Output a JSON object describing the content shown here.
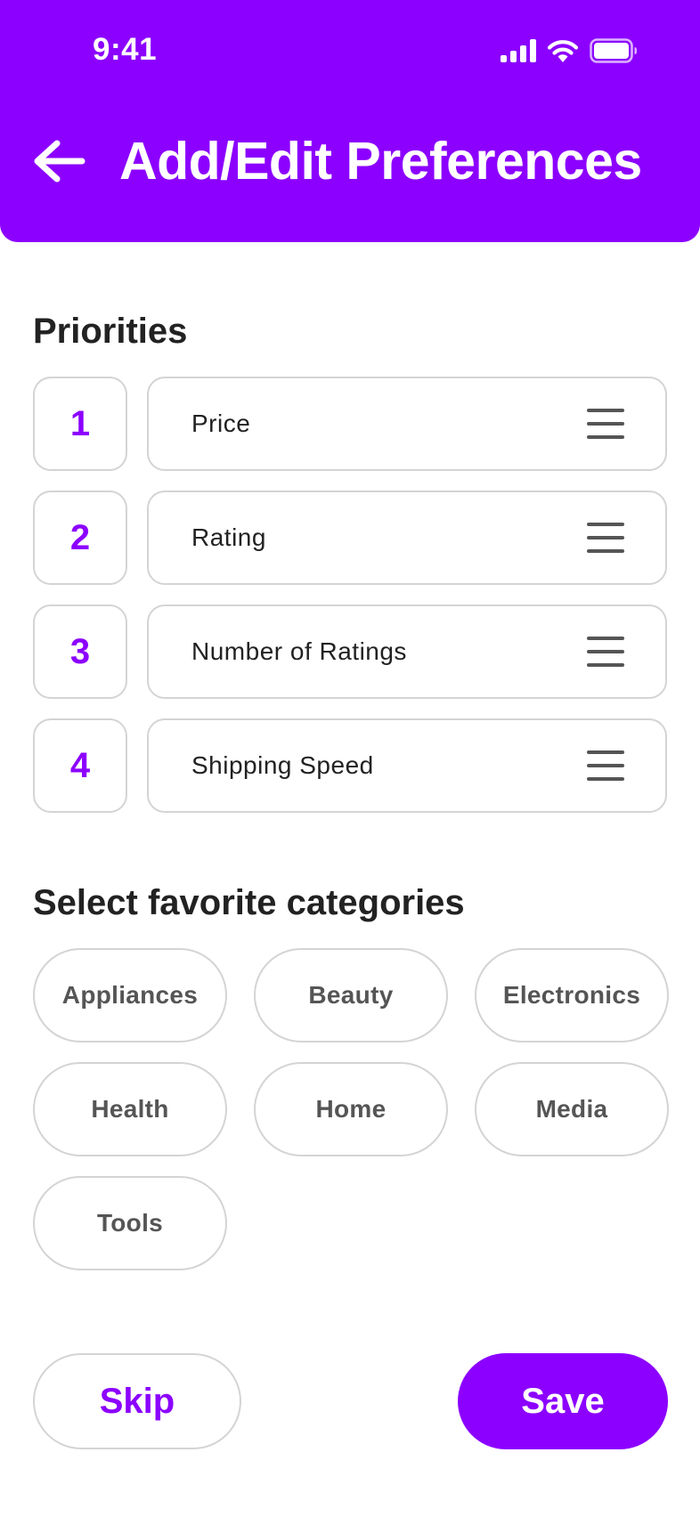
{
  "status_bar": {
    "time": "9:41",
    "icons": [
      "cellular-signal-icon",
      "wifi-icon",
      "battery-icon"
    ]
  },
  "header": {
    "back_icon": "arrow-left-icon",
    "title": "Add/Edit Preferences"
  },
  "priorities": {
    "title": "Priorities",
    "items": [
      {
        "rank": "1",
        "label": "Price"
      },
      {
        "rank": "2",
        "label": "Rating"
      },
      {
        "rank": "3",
        "label": "Number of Ratings"
      },
      {
        "rank": "4",
        "label": "Shipping Speed"
      }
    ],
    "handle_icon": "drag-handle-icon"
  },
  "categories": {
    "title": "Select favorite categories",
    "items": [
      "Appliances",
      "Beauty",
      "Electronics",
      "Health",
      "Home",
      "Media",
      "Tools"
    ]
  },
  "actions": {
    "skip_label": "Skip",
    "save_label": "Save"
  },
  "colors": {
    "accent": "#8C00FF",
    "border": "#d4d4d4",
    "text": "#222222",
    "chip_text": "#555555"
  }
}
